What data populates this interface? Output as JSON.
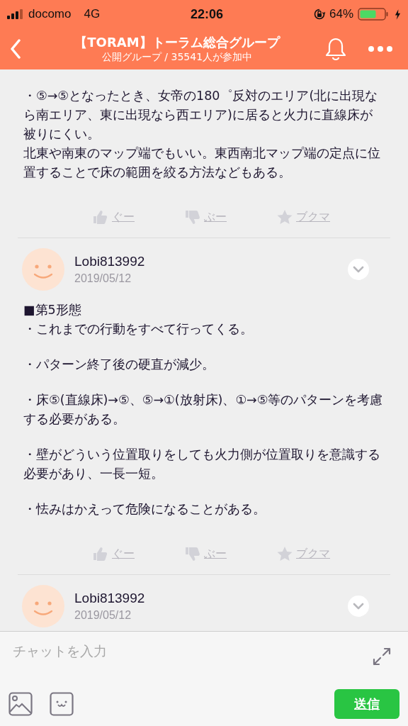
{
  "status_bar": {
    "carrier": "docomo",
    "network": "4G",
    "time": "22:06",
    "battery": "64%"
  },
  "header": {
    "title": "【TORAM】トーラム総合グループ",
    "subtitle": "公開グループ / 35541人が参加中"
  },
  "posts": [
    {
      "paragraphs": [
        [
          "・⑤→⑤となったとき、女帝の180゜反対のエリア(北に出現なら南エリア、東に出現なら西エリア)に居ると火力に直線床が被りにくい。",
          "北東や南東のマップ端でもいい。東西南北マップ端の定点に位置することで床の範囲を絞る方法などもある。"
        ]
      ],
      "reactions": [
        "ぐー",
        "ぶー",
        "ブクマ"
      ]
    },
    {
      "author": "Lobi813992",
      "date": "2019/05/12",
      "paragraphs": [
        [
          "■第5形態",
          "・これまでの行動をすべて行ってくる。"
        ],
        [
          "・パターン終了後の硬直が減少。"
        ],
        [
          "・床⑤(直線床)→⑤、⑤→①(放射床)、①→⑤等のパターンを考慮する必要がある。"
        ],
        [
          "・壁がどういう位置取りをしても火力側が位置取りを意識する必要があり、一長一短。"
        ],
        [
          "・怯みはかえって危険になることがある。"
        ]
      ],
      "reactions": [
        "ぐー",
        "ぶー",
        "ブクマ"
      ]
    },
    {
      "author": "Lobi813992",
      "date": "2019/05/12"
    }
  ],
  "composer": {
    "placeholder": "チャットを入力",
    "send": "送信"
  }
}
